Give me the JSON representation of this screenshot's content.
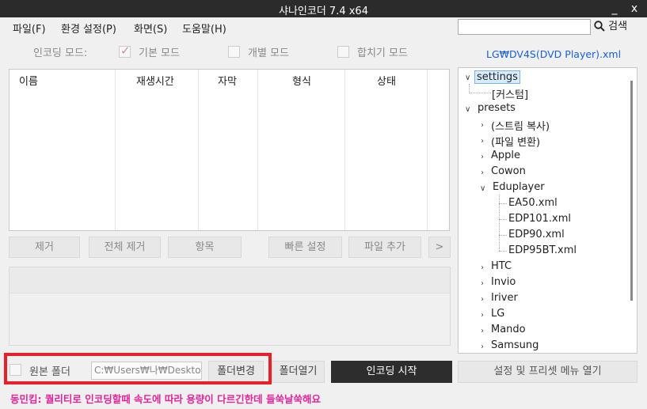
{
  "window": {
    "title": "샤나인코더  7.4  x64",
    "minimize_label": "_",
    "close_label": "x"
  },
  "menu": {
    "items": [
      "파일(F)",
      "환경 설정(P)",
      "화면(S)",
      "도움말(H)"
    ]
  },
  "search": {
    "value": "",
    "button_label": "검색"
  },
  "encode_mode": {
    "label": "인코딩 모드:",
    "options": [
      {
        "label": "기본 모드",
        "checked": true
      },
      {
        "label": "개별 모드",
        "checked": false
      },
      {
        "label": "합치기 모드",
        "checked": false
      }
    ]
  },
  "preset_file": "LG₩DV4S(DVD Player).xml",
  "list": {
    "columns": [
      "이름",
      "재생시간",
      "자막",
      "형식",
      "상태"
    ],
    "rows": []
  },
  "list_buttons": {
    "remove": "제거",
    "remove_all": "전체 제거",
    "items": "항목",
    "quick_settings": "빠른 설정",
    "add_file": "파일 추가",
    "more": ">"
  },
  "tree": {
    "root": "settings",
    "custom": "[커스텀]",
    "presets_label": "presets",
    "presets": [
      "(스트림 복사)",
      "(파일 변환)",
      "Apple",
      "Cowon",
      "Eduplayer",
      "HTC",
      "Invio",
      "Iriver",
      "LG",
      "Mando",
      "Samsung"
    ],
    "eduplayer_children": [
      "EA50.xml",
      "EDP101.xml",
      "EDP90.xml",
      "EDP95BT.xml"
    ]
  },
  "output": {
    "source_folder_label": "원본 폴더",
    "source_folder_checked": false,
    "path_value": "C:₩Users₩나₩Deskto|",
    "change_folder_label": "폴더변경",
    "open_folder_label": "폴더열기",
    "start_encoding_label": "인코딩 시작",
    "settings_menu_label": "설정 및 프리셋 메뉴 열기"
  },
  "status_message": "동민킴: 퀄리티로 인코딩할때 속도에 따라 용량이 다르긴한데 들쑥날쑥해요",
  "colors": {
    "titlebar": "#2b2b2b",
    "highlight_box": "#e8202a",
    "status_text": "#e0249a",
    "link": "#1a5fd1"
  }
}
